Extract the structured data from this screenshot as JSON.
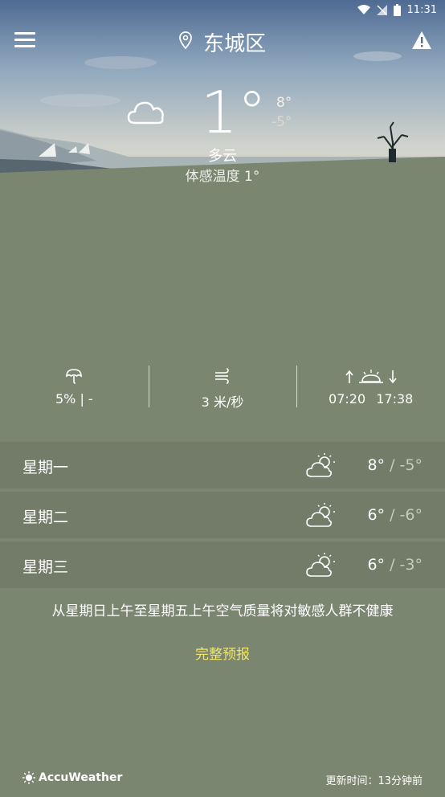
{
  "status_bar": {
    "time": "11:31"
  },
  "header": {
    "location": "东城区"
  },
  "current": {
    "temperature": "1°",
    "high": "8°",
    "low": "-5°",
    "condition": "多云",
    "feels_like": "体感温度 1°"
  },
  "stats": {
    "precip": "5% | -",
    "wind": "3 米/秒",
    "sunrise": "07:20",
    "sunset": "17:38"
  },
  "forecast": [
    {
      "day": "星期一",
      "high": "8°",
      "low": "-5°",
      "icon": "partly-sunny-icon"
    },
    {
      "day": "星期二",
      "high": "6°",
      "low": "-6°",
      "icon": "partly-sunny-icon"
    },
    {
      "day": "星期三",
      "high": "6°",
      "low": "-3°",
      "icon": "partly-sunny-icon"
    }
  ],
  "forecast_separator": "/",
  "air_quality": "从星期日上午至星期五上午空气质量将对敏感人群不健康",
  "full_forecast_label": "完整预报",
  "brand": "AccuWeather",
  "updated": "更新时间：13分钟前"
}
